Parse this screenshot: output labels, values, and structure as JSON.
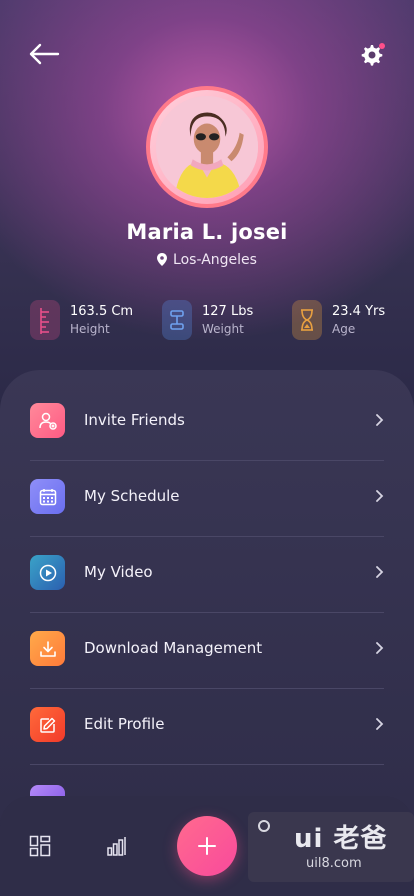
{
  "profile": {
    "name": "Maria L. josei",
    "location": "Los-Angeles"
  },
  "stats": [
    {
      "value": "163.5 Cm",
      "label": "Height",
      "icon": "ruler-icon",
      "color": "#e8508a"
    },
    {
      "value": "127 Lbs",
      "label": "Weight",
      "icon": "dumbbell-icon",
      "color": "#5a8de8"
    },
    {
      "value": "23.4 Yrs",
      "label": "Age",
      "icon": "hourglass-icon",
      "color": "#e8a040"
    }
  ],
  "menu": [
    {
      "label": "Invite Friends",
      "icon": "add-user-icon",
      "color": "#ff6f8e"
    },
    {
      "label": "My Schedule",
      "icon": "calendar-icon",
      "color": "#7a7cf5"
    },
    {
      "label": "My Video",
      "icon": "play-icon",
      "color": "#2f86c4"
    },
    {
      "label": "Download Management",
      "icon": "download-icon",
      "color": "#ff8a4a"
    },
    {
      "label": "Edit Profile",
      "icon": "edit-icon",
      "color": "#ff5a3a"
    }
  ],
  "watermark": {
    "brand": "ui 老爸",
    "url": "uil8.com"
  }
}
